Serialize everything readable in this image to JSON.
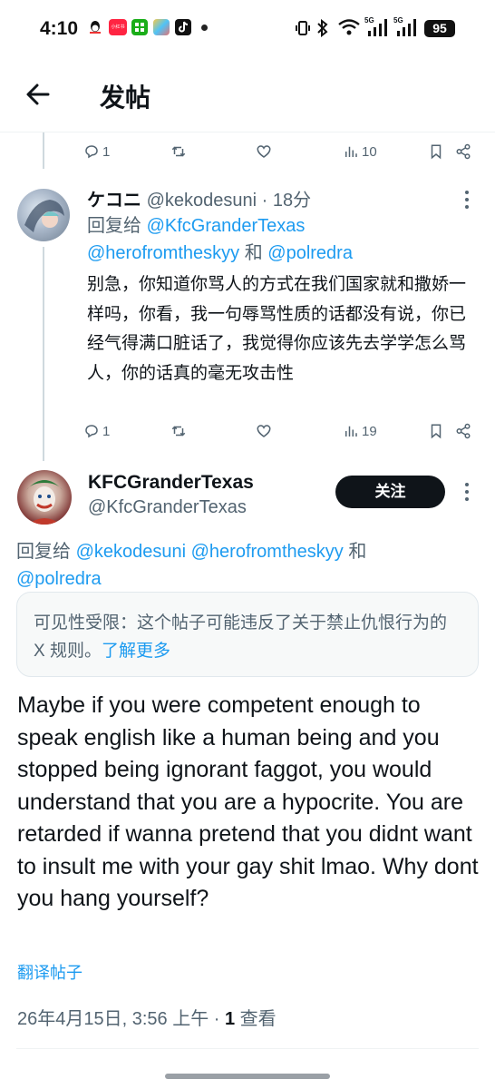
{
  "status_bar": {
    "time": "4:10",
    "battery": "95",
    "signal_1": "5G",
    "signal_2": "5G",
    "app_badge_text": "小红书"
  },
  "header": {
    "title": "发帖"
  },
  "prev_tweet_actions": {
    "replies": "1",
    "views": "10"
  },
  "reply_tweet": {
    "display_name": "ケコニ",
    "handle": "@kekodesuni",
    "time": "· 18分",
    "reply_prefix": "回复给",
    "reply_user_1": "@KfcGranderTexas",
    "reply_user_2": "@herofromtheskyy",
    "reply_and": "和",
    "reply_user_3": "@polredra",
    "text": "别急，你知道你骂人的方式在我们国家就和撒娇一样吗，你看，我一句辱骂性质的话都没有说，你已经气得满口脏话了，我觉得你应该先去学学怎么骂人，你的话真的毫无攻击性",
    "replies": "1",
    "views": "19"
  },
  "main_tweet": {
    "display_name": "KFCGranderTexas",
    "handle": "@KfcGranderTexas",
    "follow_label": "关注",
    "reply_prefix": "回复给",
    "reply_user_1": "@kekodesuni",
    "reply_user_2": "@herofromtheskyy",
    "reply_and": "和",
    "reply_user_3": "@polredra",
    "notice_text": "可见性受限：这个帖子可能违反了关于禁止仇恨行为的 X 规则。",
    "notice_link": "了解更多",
    "text": "Maybe if you were competent enough to speak english like a human being and you stopped being ignorant faggot, you would understand that you are a hypocrite. You are retarded if wanna pretend that you didnt want to insult me with your gay shit lmao. Why dont you hang yourself?",
    "translate_label": "翻译帖子",
    "timestamp": "26年4月15日, 3:56 上午 · ",
    "view_count": "1",
    "view_label": " 查看"
  }
}
